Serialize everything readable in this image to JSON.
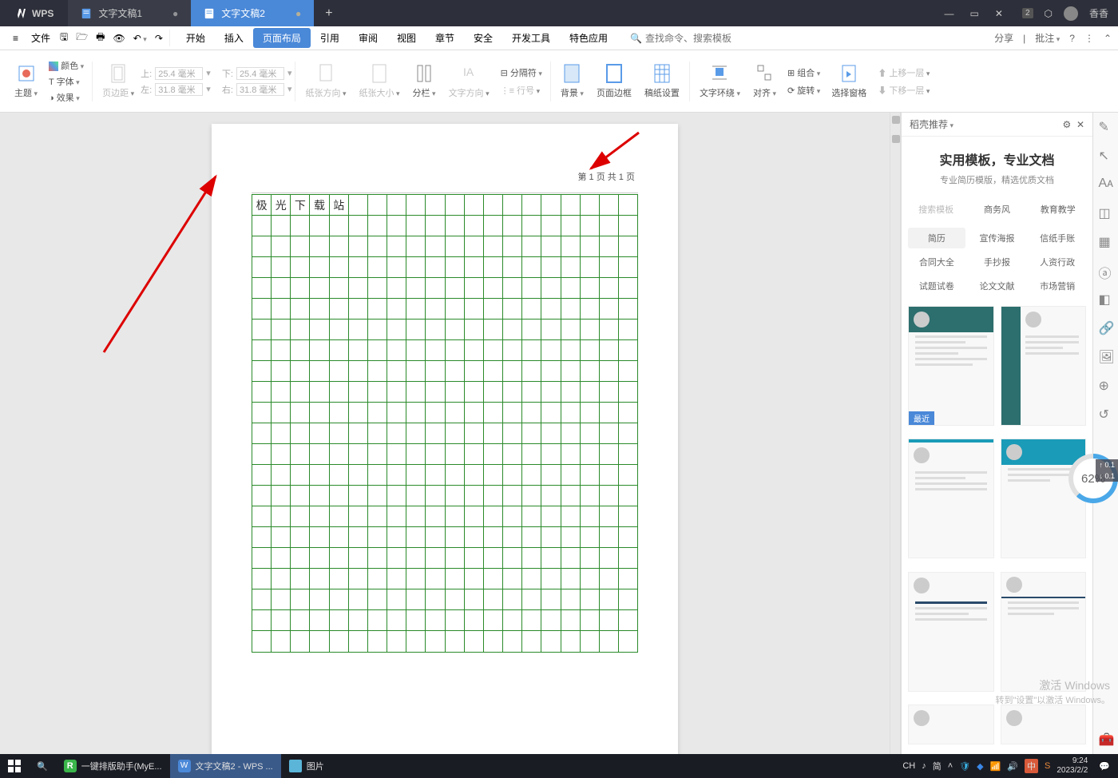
{
  "app": "WPS",
  "tabs": [
    {
      "label": "文字文稿1",
      "active": false
    },
    {
      "label": "文字文稿2",
      "active": true
    }
  ],
  "user_name": "香香",
  "badge": "2",
  "menu": {
    "file": "文件",
    "items": [
      "开始",
      "插入",
      "页面布局",
      "引用",
      "审阅",
      "视图",
      "章节",
      "安全",
      "开发工具",
      "特色应用"
    ],
    "active": "页面布局",
    "search_placeholder": "查找命令、搜索模板",
    "share": "分享",
    "annotate": "批注"
  },
  "ribbon": {
    "theme": "主题",
    "color": "颜色",
    "font": "字体",
    "effect": "效果",
    "pagemargin": "页边距",
    "top_label": "上:",
    "bottom_label": "下:",
    "left_label": "左:",
    "right_label": "右:",
    "top": "25.4 毫米",
    "bottom": "25.4 毫米",
    "left": "31.8 毫米",
    "right": "31.8 毫米",
    "orientation": "纸张方向",
    "size": "纸张大小",
    "columns": "分栏",
    "textdir": "文字方向",
    "break": "分隔符",
    "lineno": "行号",
    "background": "背景",
    "pageborder": "页面边框",
    "manuscript": "稿纸设置",
    "wrap": "文字环绕",
    "align": "对齐",
    "group": "组合",
    "rotate": "旋转",
    "selectpane": "选择窗格",
    "moveup": "上移一层",
    "movedown": "下移一层"
  },
  "page_text": {
    "pagecount": "第 1 页 共 1 页",
    "chars": [
      "极",
      "光",
      "下",
      "载",
      "站"
    ]
  },
  "right": {
    "title": "稻壳推荐",
    "headline": "实用模板，专业文档",
    "sub": "专业简历模版，精选优质文档",
    "searchph": "搜索模板",
    "tab_biz": "商务风",
    "tab_edu": "教育教学",
    "cats": [
      "简历",
      "宣传海报",
      "信纸手账",
      "合同大全",
      "手抄报",
      "人资行政",
      "试题试卷",
      "论文文献",
      "市场营销"
    ],
    "active_cat": "简历",
    "recent": "最近"
  },
  "gauge": "62%",
  "gauge_up": "0.1",
  "gauge_dn": "0.1",
  "watermark": {
    "l1": "激活 Windows",
    "l2": "转到\"设置\"以激活 Windows。"
  },
  "taskbar": {
    "app1": "一键排版助手(MyE...",
    "app2": "文字文稿2 - WPS ...",
    "app3": "图片",
    "ime": "CH",
    "ime2": "简",
    "ime3": "中",
    "time": "9:24",
    "date": "2023/2/2"
  }
}
